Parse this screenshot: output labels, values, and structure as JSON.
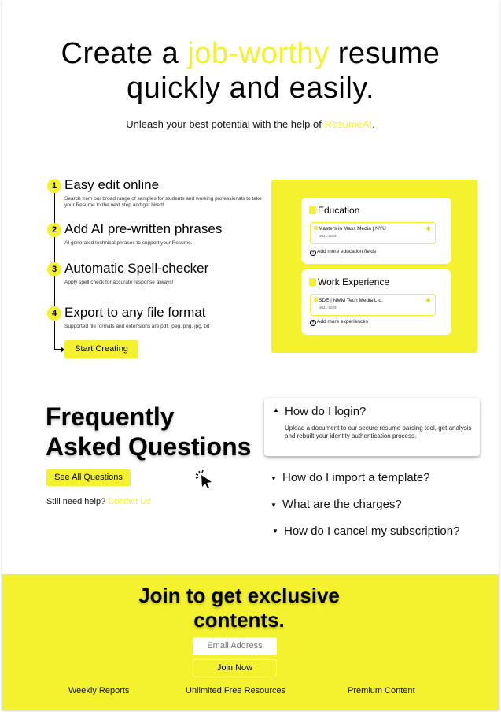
{
  "hero": {
    "title_pre": "Create a ",
    "title_highlight": "job-worthy",
    "title_post_line1": " resume",
    "title_line2": "quickly and easily.",
    "subtitle_pre": "Unleash your best potential with the help of ",
    "subtitle_brand": "ResumeAI",
    "subtitle_post": "."
  },
  "steps": [
    {
      "num": "1",
      "title": "Easy edit online",
      "desc": "Search from our broad range of samples for students and working professionals to take your Resume to the next step and get hired!"
    },
    {
      "num": "2",
      "title": "Add AI pre-written phrases",
      "desc": "AI generated technical phrases to support your Resume."
    },
    {
      "num": "3",
      "title": "Automatic Spell-checker",
      "desc": "Apply spell check for accurate response always!"
    },
    {
      "num": "4",
      "title": "Export to any file format",
      "desc": "Supported file formats and extensions are pdf, jpeg, png, jpg, txt"
    }
  ],
  "cta_label": "Start Creating",
  "panel": {
    "education": {
      "title": "Education",
      "entry": "Masters in Mass Media | NYU",
      "date": "2021-2023",
      "add_label": "Add more education fields"
    },
    "work": {
      "title": "Work Experience",
      "entry": "SDE | NMM Tech Media Ltd.",
      "date": "2021-2023",
      "add_label": "Add more experiences"
    }
  },
  "faq": {
    "title_line1": "Frequently",
    "title_line2": "Asked Questions",
    "see_all": "See All Questions",
    "help_text": "Still need help? ",
    "help_link": "Contact Us",
    "items": [
      {
        "q": "How do I login?",
        "a": "Upload a document to our secure resume parsing tool, get analysis and rebuilt your identity authentication process.",
        "expanded": true
      },
      {
        "q": "How do I import a template?",
        "expanded": false
      },
      {
        "q": "What are the charges?",
        "expanded": false
      },
      {
        "q": "How do I cancel my subscription?",
        "expanded": false
      }
    ]
  },
  "footer": {
    "title_line1": "Join to get exclusive",
    "title_line2": "contents.",
    "email_placeholder": "Email Address",
    "join_label": "Join Now",
    "features": [
      "Weekly Reports",
      "Unlimited Free Resources",
      "Premium Content"
    ]
  },
  "colors": {
    "accent": "#f4f12f",
    "text": "#000000",
    "background": "#ffffff"
  },
  "icons": [
    "chevron-up-icon",
    "chevron-down-icon",
    "cursor-click-icon",
    "plus-circle-icon",
    "star-icon",
    "document-icon"
  ]
}
